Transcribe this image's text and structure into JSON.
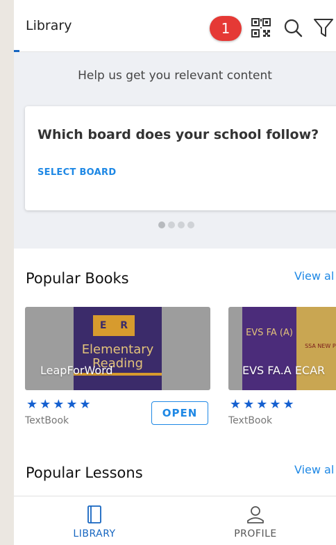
{
  "appbar": {
    "title": "Library",
    "badge_count": "1",
    "qr_icon": "qr-code-icon",
    "search_icon": "search-icon",
    "filter_icon": "filter-icon"
  },
  "banner": {
    "help_text": "Help us get you relevant content",
    "question": "Which board does your school follow?",
    "select_label": "SELECT BOARD",
    "active_dot": 0,
    "dot_count": 4
  },
  "popular_books": {
    "title": "Popular Books",
    "view_all": "View al",
    "items": [
      {
        "title": "LeapForWord",
        "cover_letters": [
          "E",
          "R"
        ],
        "cover_text": "Elementary Reading",
        "rating": "★★★★★",
        "type": "TextBook",
        "action": "OPEN"
      },
      {
        "title": "EVS FA.A ECAR",
        "cover_text": "EVS FA (A)",
        "cover_badge": "SSA NEW PED",
        "rating": "★★★★★",
        "type": "TextBook"
      }
    ]
  },
  "popular_lessons": {
    "title": "Popular Lessons",
    "view_all": "View al"
  },
  "bottom_nav": {
    "items": [
      {
        "label": "LIBRARY",
        "icon": "book-icon",
        "active": true,
        "color": "#1565c0"
      },
      {
        "label": "PROFILE",
        "icon": "profile-icon",
        "active": false,
        "color": "#555555"
      }
    ]
  },
  "colors": {
    "accent": "#1e88e5",
    "badge": "#e53935",
    "stars": "#1560d0"
  }
}
